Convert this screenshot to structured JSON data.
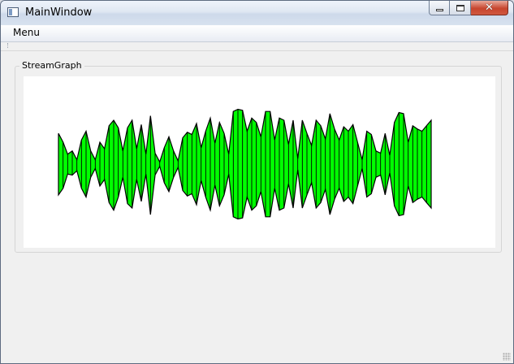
{
  "window": {
    "title": "MainWindow"
  },
  "menubar": {
    "items": [
      "Menu"
    ]
  },
  "group": {
    "title": "StreamGraph"
  },
  "colors": {
    "fill": "#00ff00",
    "stroke": "#000000",
    "background": "#ffffff"
  },
  "chart_data": {
    "type": "area",
    "title": "",
    "x": [
      0,
      1,
      2,
      3,
      4,
      5,
      6,
      7,
      8,
      9,
      10,
      11,
      12,
      13,
      14,
      15,
      16,
      17,
      18,
      19,
      20,
      21,
      22,
      23,
      24,
      25,
      26,
      27,
      28,
      29,
      30,
      31,
      32,
      33,
      34,
      35,
      36,
      37,
      38,
      39,
      40,
      41,
      42,
      43,
      44,
      45,
      46,
      47,
      48,
      49,
      50,
      51,
      52,
      53,
      54,
      55,
      56,
      57,
      58,
      59,
      60,
      61,
      62,
      63,
      64,
      65,
      66,
      67,
      68,
      69,
      70,
      71,
      72,
      73,
      74,
      75,
      76,
      77,
      78,
      79,
      80,
      81,
      82,
      83,
      84,
      85,
      86,
      87,
      88,
      89,
      90,
      91,
      92,
      93,
      94,
      95,
      96
    ],
    "upper": [
      28,
      20,
      9,
      12,
      4,
      22,
      30,
      12,
      4,
      20,
      14,
      35,
      40,
      33,
      12,
      33,
      40,
      14,
      36,
      9,
      44,
      10,
      2,
      15,
      25,
      12,
      3,
      24,
      29,
      27,
      37,
      15,
      30,
      42,
      19,
      38,
      28,
      9,
      48,
      50,
      49,
      30,
      42,
      38,
      25,
      48,
      48,
      22,
      42,
      40,
      18,
      40,
      5,
      40,
      28,
      17,
      40,
      35,
      23,
      46,
      32,
      22,
      34,
      30,
      36,
      20,
      4,
      30,
      27,
      12,
      10,
      28,
      8,
      38,
      47,
      46,
      20,
      35,
      32,
      30,
      35,
      40
    ],
    "lower": [
      28,
      22,
      9,
      10,
      6,
      22,
      30,
      12,
      4,
      20,
      14,
      35,
      42,
      30,
      12,
      36,
      40,
      14,
      34,
      9,
      46,
      10,
      2,
      17,
      25,
      12,
      3,
      24,
      29,
      27,
      37,
      15,
      30,
      42,
      19,
      38,
      28,
      9,
      48,
      50,
      49,
      30,
      42,
      38,
      25,
      48,
      48,
      22,
      42,
      40,
      18,
      40,
      5,
      40,
      28,
      17,
      40,
      35,
      23,
      46,
      32,
      22,
      34,
      30,
      36,
      20,
      4,
      30,
      27,
      12,
      10,
      28,
      8,
      38,
      47,
      46,
      20,
      35,
      32,
      30,
      35,
      40
    ]
  }
}
